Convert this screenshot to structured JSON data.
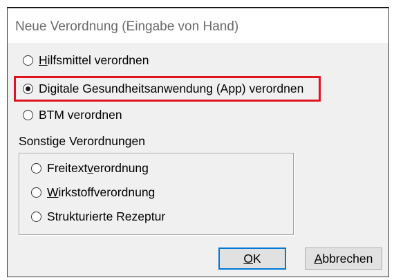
{
  "window": {
    "title": "Neue Verordnung (Eingabe von Hand)"
  },
  "options": [
    {
      "label": "Hilfsmittel verordnen",
      "access_key": "H",
      "selected": false
    },
    {
      "label": "Digitale Gesundheitsanwendung (App) verordnen",
      "selected": true,
      "highlighted": true
    },
    {
      "label": "BTM verordnen",
      "selected": false
    }
  ],
  "other_group": {
    "label": "Sonstige Verordnungen",
    "options": [
      {
        "label": "Freitextverordnung",
        "access_key": "v",
        "selected": false
      },
      {
        "label": "Wirkstoffverordnung",
        "access_key": "W",
        "selected": false
      },
      {
        "label": "Strukturierte Rezeptur",
        "selected": false
      }
    ]
  },
  "buttons": {
    "ok": {
      "label": "OK",
      "access_key": "O",
      "default": true
    },
    "cancel": {
      "label": "Abbrechen",
      "access_key": "A",
      "default": false
    }
  },
  "colors": {
    "dialog_background": "#F0F0F0",
    "titlebar_background": "#FFFFFF",
    "title_text": "#6A6A6A",
    "accent": "#0078D7",
    "annotation_highlight": "#E0141E"
  }
}
